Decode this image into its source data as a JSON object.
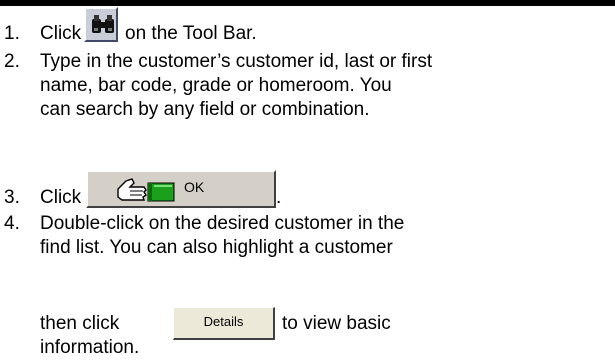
{
  "steps": [
    {
      "number": "1.",
      "before": "Click",
      "after": "on the Tool Bar."
    },
    {
      "number": "2.",
      "lines": [
        "Type in the customer’s customer id, last or first",
        "name, bar code, grade or homeroom.  You",
        "can search by any field or combination."
      ]
    },
    {
      "number": "3.",
      "before": "Click",
      "after": "."
    },
    {
      "number": "4.",
      "lines": [
        "Double-click on the desired customer in the",
        "find list.  You can also highlight a customer"
      ],
      "then_text": "then click",
      "after": "to view basic",
      "last_line": "information."
    }
  ],
  "buttons": {
    "find": {
      "icon": "binoculars-icon"
    },
    "ok": {
      "label": "OK",
      "icon": "thumbs-up-icon"
    },
    "details": {
      "label": "Details"
    }
  },
  "colors": {
    "rule": "#000000",
    "find_button_face": "#c9cdd8",
    "ok_button_face": "#d4d0c8",
    "ok_icon_green": "#1aa01a"
  }
}
